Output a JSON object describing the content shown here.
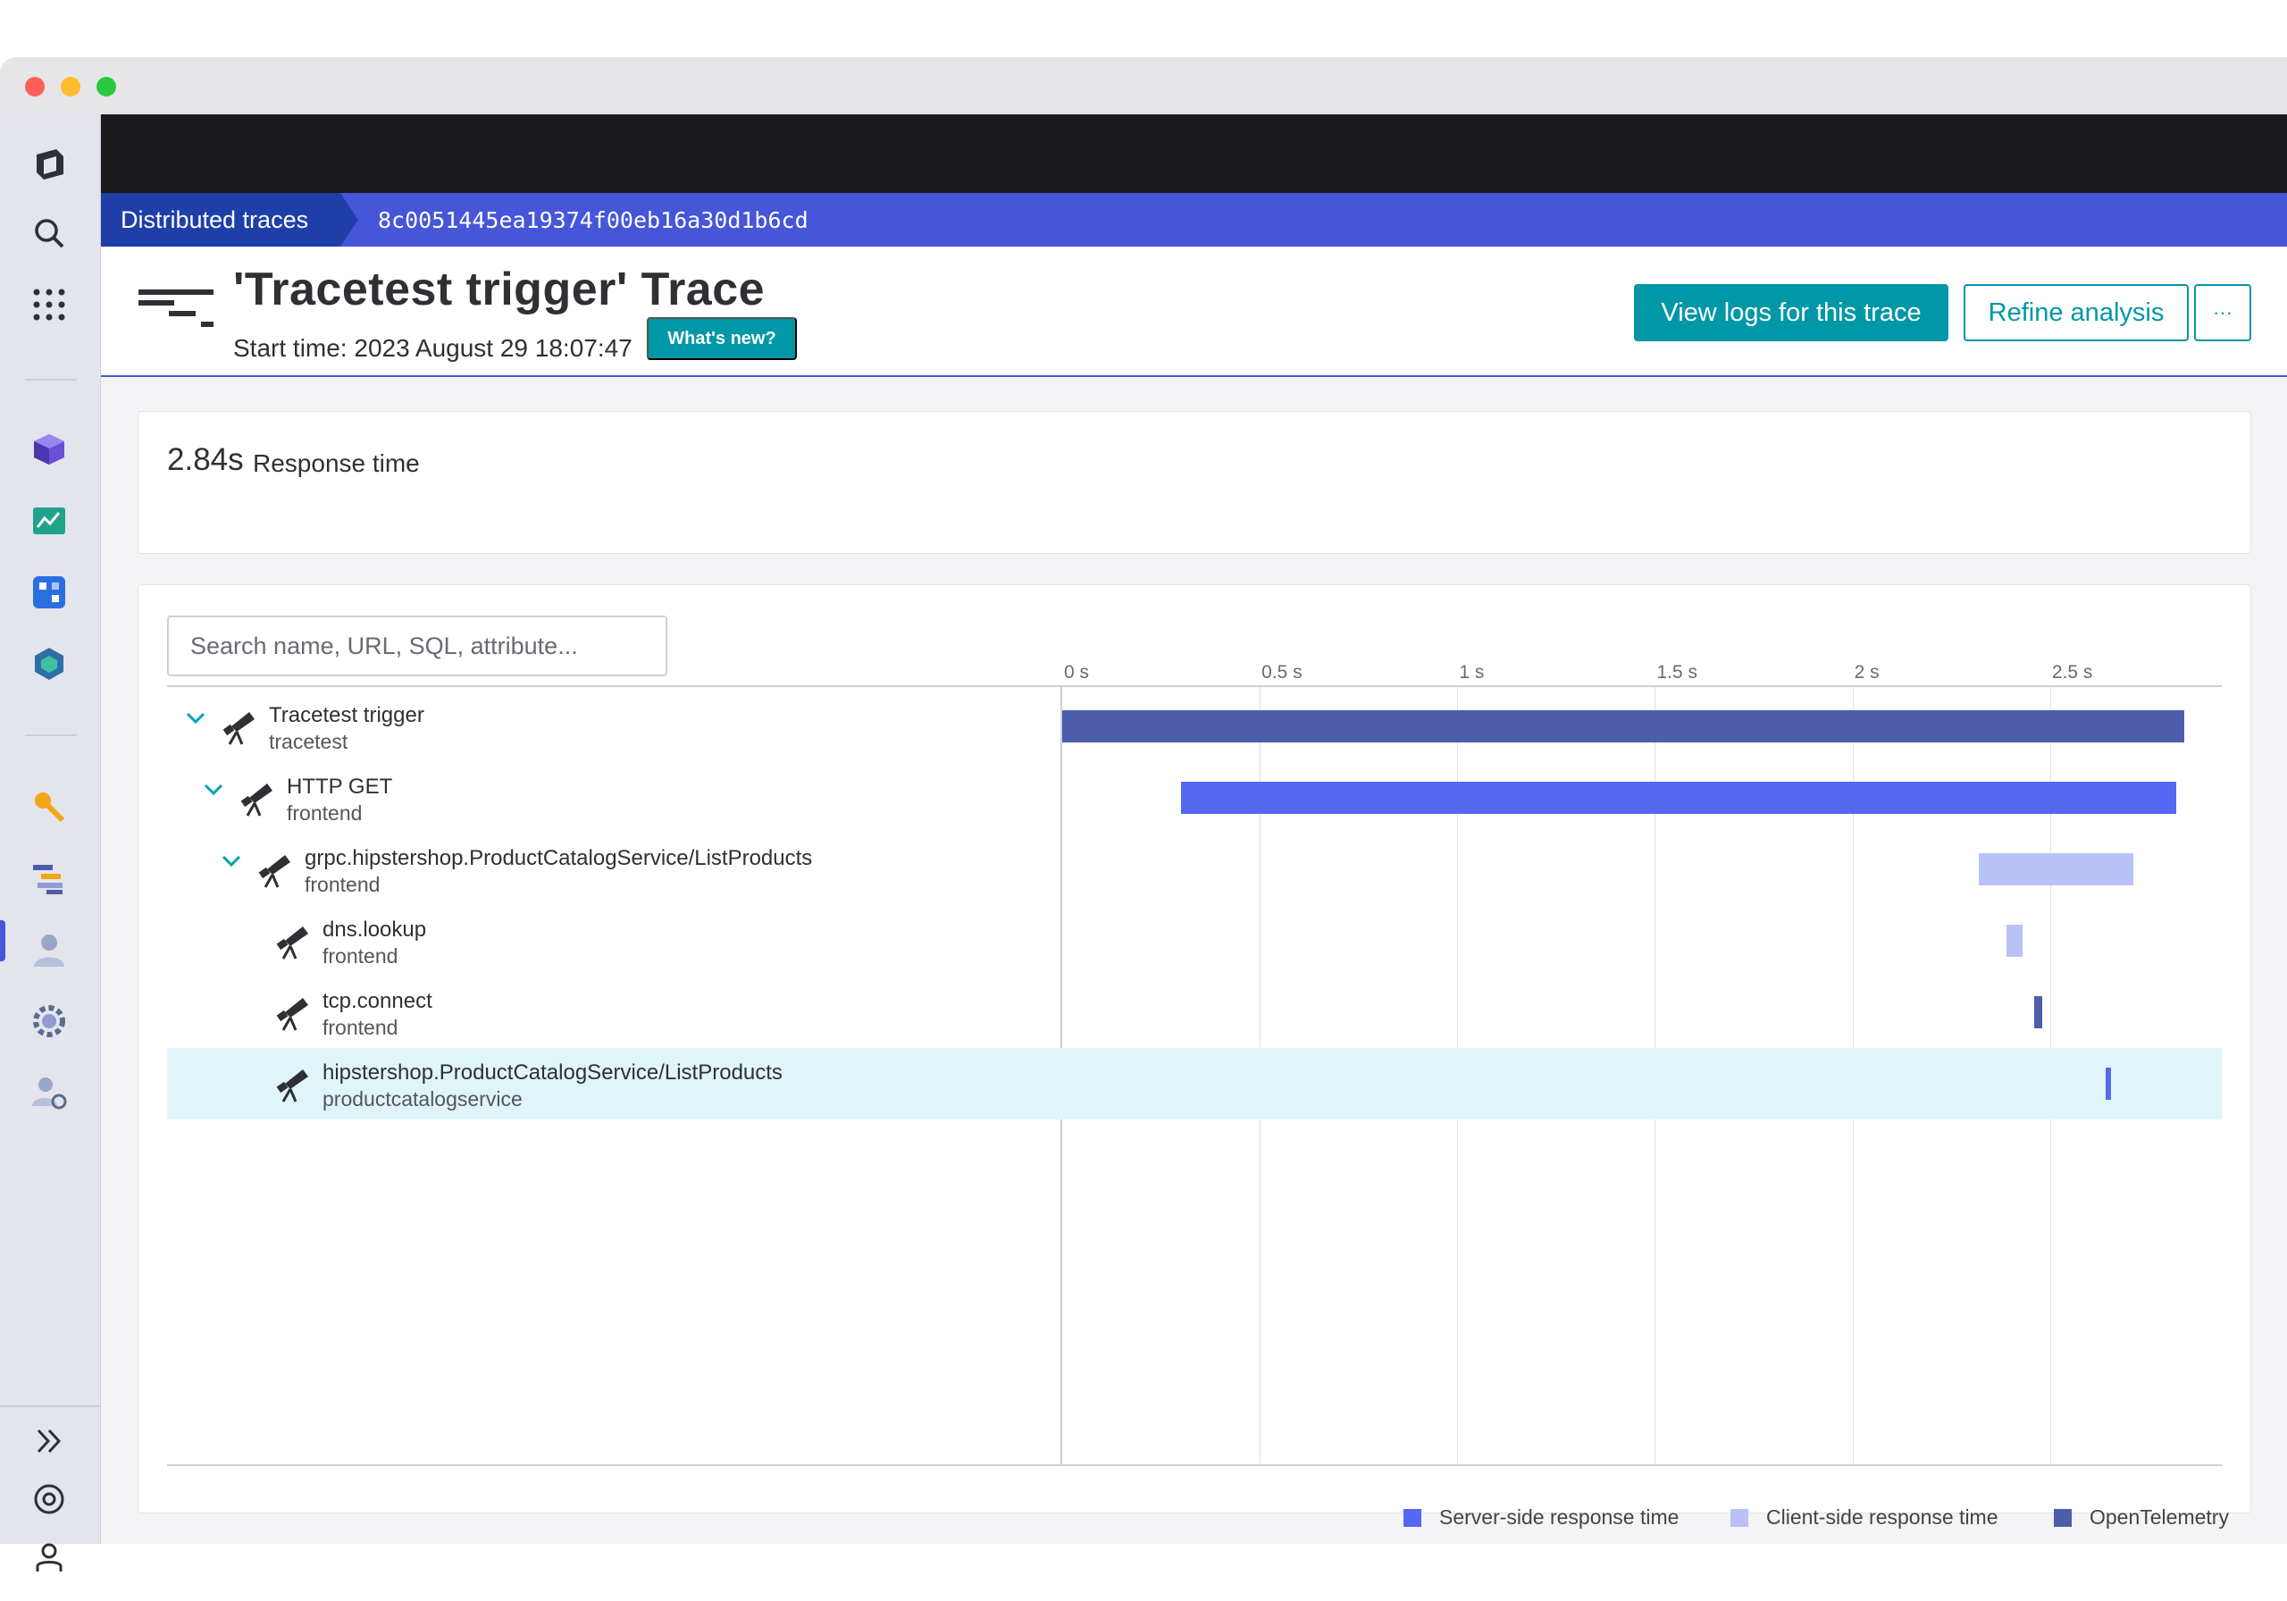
{
  "breadcrumbs": {
    "root": "Distributed traces",
    "trace_id": "8c0051445ea19374f00eb16a30d1b6cd"
  },
  "header": {
    "title": "'Tracetest trigger' Trace",
    "start_time": "Start time: 2023 August 29 18:07:47",
    "whats_new": "What's new?",
    "view_logs": "View logs for this trace",
    "refine": "Refine analysis",
    "more": "···"
  },
  "summary": {
    "response_value": "2.84s",
    "response_label": "Response time"
  },
  "search": {
    "placeholder": "Search name, URL, SQL, attribute..."
  },
  "timeline": {
    "max_seconds": 2.84,
    "ticks": [
      {
        "label": "0 s",
        "value": 0
      },
      {
        "label": "0.5 s",
        "value": 0.5
      },
      {
        "label": "1 s",
        "value": 1
      },
      {
        "label": "1.5 s",
        "value": 1.5
      },
      {
        "label": "2 s",
        "value": 2
      },
      {
        "label": "2.5 s",
        "value": 2.5
      }
    ]
  },
  "spans": [
    {
      "name": "Tracetest trigger",
      "service": "tracetest",
      "depth": 0,
      "expandable": true,
      "start": 0.0,
      "end": 2.84,
      "kind": "opentelemetry",
      "selected": false
    },
    {
      "name": "HTTP GET",
      "service": "frontend",
      "depth": 1,
      "expandable": true,
      "start": 0.3,
      "end": 2.82,
      "kind": "server",
      "selected": false
    },
    {
      "name": "grpc.hipstershop.ProductCatalogService/ListProducts",
      "service": "frontend",
      "depth": 2,
      "expandable": true,
      "start": 2.32,
      "end": 2.71,
      "kind": "client",
      "selected": false
    },
    {
      "name": "dns.lookup",
      "service": "frontend",
      "depth": 3,
      "expandable": false,
      "start": 2.39,
      "end": 2.43,
      "kind": "client",
      "selected": false
    },
    {
      "name": "tcp.connect",
      "service": "frontend",
      "depth": 3,
      "expandable": false,
      "start": 2.46,
      "end": 2.48,
      "kind": "opentelemetry",
      "selected": false
    },
    {
      "name": "hipstershop.ProductCatalogService/ListProducts",
      "service": "productcatalogservice",
      "depth": 3,
      "expandable": false,
      "start": 2.64,
      "end": 2.65,
      "kind": "server",
      "selected": true
    }
  ],
  "legend": [
    {
      "label": "Server-side response time",
      "color": "#5468f2"
    },
    {
      "label": "Client-side response time",
      "color": "#b9c2f6"
    },
    {
      "label": "OpenTelemetry",
      "color": "#4e5dab"
    }
  ],
  "colors": {
    "server": "#5468f2",
    "client": "#b9c2f6",
    "opentelemetry": "#4e5dab",
    "accent": "#0097a7",
    "breadcrumb": "#4556d8"
  },
  "sidebar_icons": [
    "logo-icon",
    "search-icon",
    "apps-grid-icon",
    "cube-icon",
    "dashboard-icon",
    "workflow-icon",
    "hexagon-icon",
    "key-icon",
    "traces-icon",
    "user-icon",
    "gear-icon",
    "user-settings-icon",
    "expand-icon",
    "help-icon",
    "account-icon"
  ]
}
